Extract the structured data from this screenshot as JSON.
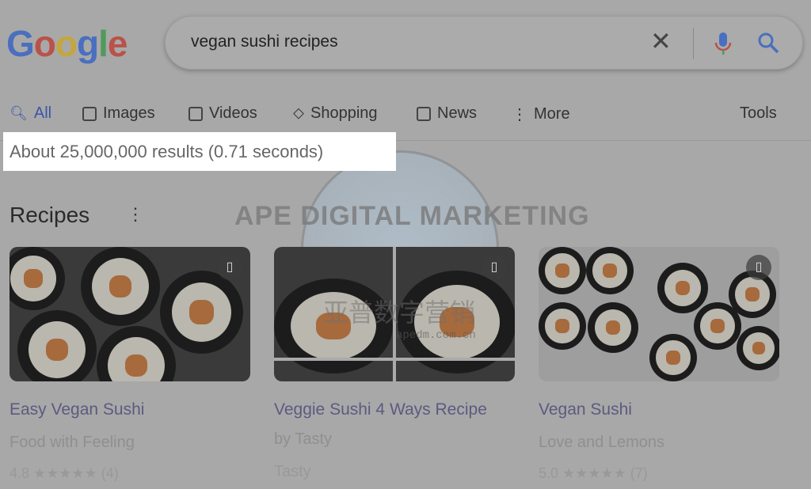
{
  "logo": "Google",
  "search": {
    "query": "vegan sushi recipes"
  },
  "tabs": [
    {
      "label": "All",
      "icon": "search-icon",
      "active": true
    },
    {
      "label": "Images",
      "icon": "image-icon"
    },
    {
      "label": "Videos",
      "icon": "play-icon"
    },
    {
      "label": "Shopping",
      "icon": "tag-icon"
    },
    {
      "label": "News",
      "icon": "news-icon"
    },
    {
      "label": "More",
      "icon": "kebab-icon"
    }
  ],
  "tools": "Tools",
  "results_stats": "About 25,000,000 results (0.71 seconds)",
  "section_title": "Recipes",
  "cards": [
    {
      "title": "Easy Vegan Sushi",
      "source": "Food with Feeling",
      "rating": "4.8 ★★★★★ (4)"
    },
    {
      "title": "Veggie Sushi 4 Ways Recipe",
      "byline": "by Tasty",
      "source": "Tasty"
    },
    {
      "title": "Vegan Sushi",
      "source": "Love and Lemons",
      "rating": "5.0 ★★★★★ (7)"
    }
  ],
  "watermark": {
    "text": "APE DIGITAL MARKETING",
    "chinese": "亚普数字营销",
    "url": "apedm.com.cn"
  },
  "colors": {
    "overlay": "#a8a8a8",
    "highlight": "#ffffff",
    "link": "#5c5a80",
    "active_tab": "#3b55a8"
  }
}
